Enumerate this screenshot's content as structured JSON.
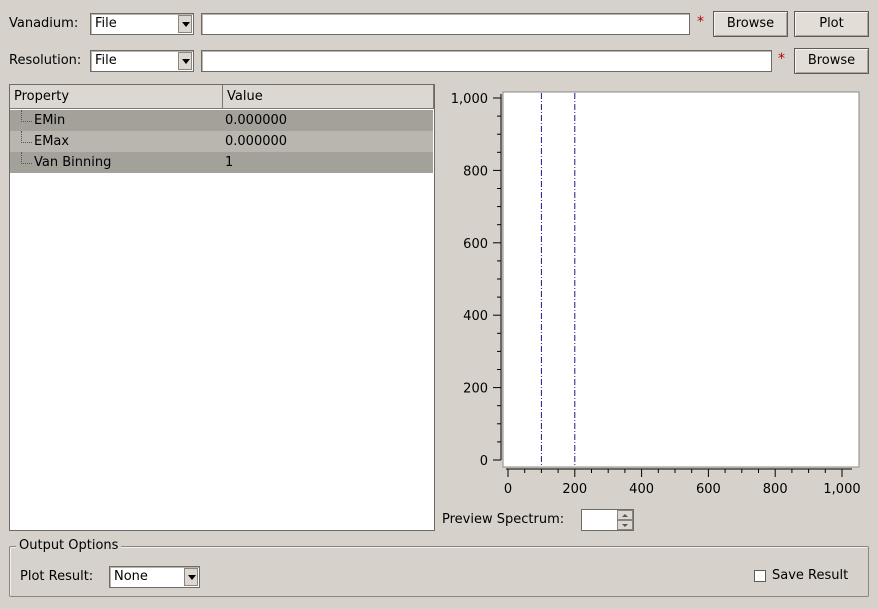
{
  "vanadium": {
    "label": "Vanadium:",
    "type_value": "File",
    "path_value": "",
    "required_mark": "*",
    "browse_label": "Browse",
    "plot_label": "Plot"
  },
  "resolution": {
    "label": "Resolution:",
    "type_value": "File",
    "path_value": "",
    "required_mark": "*",
    "browse_label": "Browse"
  },
  "properties": {
    "headers": [
      "Property",
      "Value"
    ],
    "rows": [
      {
        "name": "EMin",
        "value": "0.000000"
      },
      {
        "name": "EMax",
        "value": "0.000000"
      },
      {
        "name": "Van Binning",
        "value": "1"
      }
    ]
  },
  "chart_data": {
    "type": "line",
    "xlim": [
      0,
      1000
    ],
    "ylim": [
      0,
      1000
    ],
    "x_ticks": [
      "0",
      "200",
      "400",
      "600",
      "800",
      "1,000"
    ],
    "y_ticks": [
      "0",
      "200",
      "400",
      "600",
      "800",
      "1,000"
    ],
    "range_markers_x": [
      100,
      200
    ],
    "series": [],
    "grid": false
  },
  "preview": {
    "label": "Preview Spectrum:",
    "value": ""
  },
  "output": {
    "group_title": "Output Options",
    "plot_result_label": "Plot Result:",
    "plot_result_value": "None",
    "save_result_label": "Save Result",
    "save_result_checked": false
  }
}
